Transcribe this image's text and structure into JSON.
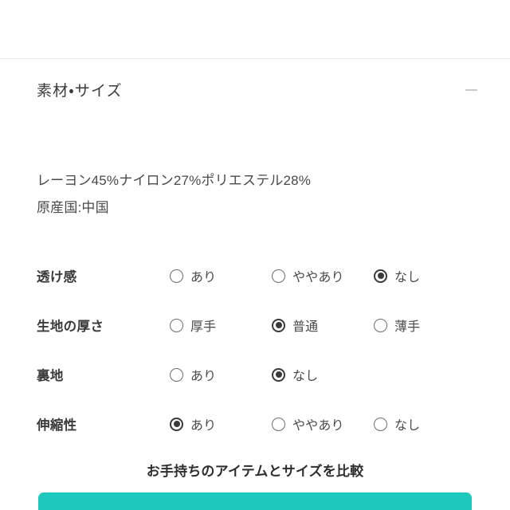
{
  "section": {
    "title": "素材・サイズ",
    "collapse_icon": "minus-icon"
  },
  "material": {
    "composition": "レーヨン45%ナイロン27%ポリエステル28%",
    "origin": "原産国:中国"
  },
  "attributes": [
    {
      "label": "透け感",
      "options": [
        {
          "label": "あり",
          "selected": false
        },
        {
          "label": "ややあり",
          "selected": false
        },
        {
          "label": "なし",
          "selected": true
        }
      ]
    },
    {
      "label": "生地の厚さ",
      "options": [
        {
          "label": "厚手",
          "selected": false
        },
        {
          "label": "普通",
          "selected": true
        },
        {
          "label": "薄手",
          "selected": false
        }
      ]
    },
    {
      "label": "裏地",
      "options": [
        {
          "label": "あり",
          "selected": false
        },
        {
          "label": "なし",
          "selected": true
        }
      ]
    },
    {
      "label": "伸縮性",
      "options": [
        {
          "label": "あり",
          "selected": true
        },
        {
          "label": "ややあり",
          "selected": false
        },
        {
          "label": "なし",
          "selected": false
        }
      ]
    }
  ],
  "compare": {
    "title": "お手持ちのアイテムとサイズを比較",
    "button_color": "#1ec8bd"
  }
}
